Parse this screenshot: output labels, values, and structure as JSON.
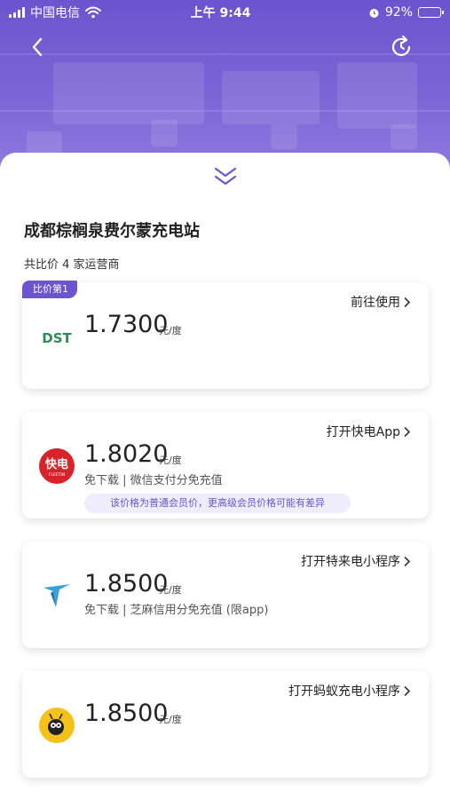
{
  "status_bar": {
    "carrier": "中国电信",
    "time": "上午 9:44",
    "battery": "92%",
    "battery_level": 0.92
  },
  "station": {
    "name": "成都棕榈泉费尔蒙充电站",
    "compare_count": "共比价 4 家运营商"
  },
  "offers": [
    {
      "badge": "比价第1",
      "action_label": "前往使用",
      "logo_icon": "dst-logo-icon",
      "price": "1.7300",
      "unit": "元/度"
    },
    {
      "action_label": "打开快电App",
      "logo_icon": "kuaidian-logo-icon",
      "price": "1.8020",
      "unit": "元/度",
      "desc": "免下载 | 微信支付分免充值",
      "note": "该价格为普通会员价，更高级会员价格可能有差异"
    },
    {
      "action_label": "打开特来电小程序",
      "logo_icon": "teld-logo-icon",
      "price": "1.8500",
      "unit": "元/度",
      "desc": "免下载 | 芝麻信用分免充值 (限app)"
    },
    {
      "action_label": "打开蚂蚁充电小程序",
      "logo_icon": "ant-charge-logo-icon",
      "price": "1.8500",
      "unit": "元/度"
    }
  ],
  "logos": {
    "dst_text": "DST",
    "kuaidian_text": "快电",
    "kuaidian_sub": "FLEETIN"
  },
  "colors": {
    "accent": "#6a55cf",
    "dst_green": "#2e8b57",
    "kuaidian_red": "#d9222a",
    "teld_blue": "#3aa0d8",
    "ant_yellow": "#f5c21b"
  }
}
